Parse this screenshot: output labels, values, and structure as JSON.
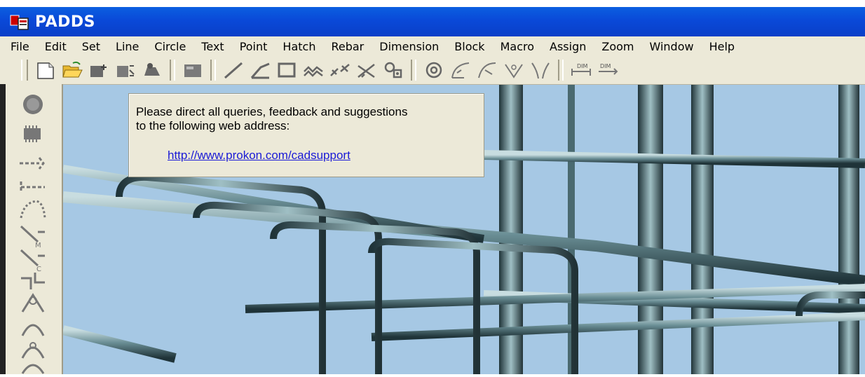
{
  "window": {
    "title": "PADDS"
  },
  "menu": {
    "items": [
      "File",
      "Edit",
      "Set",
      "Line",
      "Circle",
      "Text",
      "Point",
      "Hatch",
      "Rebar",
      "Dimension",
      "Block",
      "Macro",
      "Assign",
      "Zoom",
      "Window",
      "Help"
    ]
  },
  "toolbar": {
    "icons": [
      "new-file-icon",
      "open-folder-icon",
      "insert-block-icon",
      "explode-block-icon",
      "gallery-icon",
      "layer-icon",
      "line-icon",
      "polyline-icon",
      "rectangle-icon",
      "zigzag-icon",
      "break-line-icon",
      "cross-line-icon",
      "chain-icon",
      "circle-point-icon",
      "arc-icon",
      "angle-r-icon",
      "vertex-icon",
      "curve-icon",
      "dimension-icon"
    ],
    "dim_label": "DIM"
  },
  "lefttoolbar": {
    "icons": [
      "globe-icon",
      "chip-icon",
      "line-end-icon",
      "line-start-icon",
      "dotted-curve-icon",
      "rebar-m-icon",
      "rebar-c-icon",
      "hook-icon",
      "bend-r-icon",
      "bend-icon",
      "bend-2d-icon",
      "bend-small-icon"
    ]
  },
  "info": {
    "line1": "Please direct all queries, feedback and suggestions",
    "line2": "to the following web address:",
    "link": "http://www.prokon.com/cadsupport"
  },
  "colors": {
    "titlebar": "#0a49d8",
    "chrome": "#ece9d8",
    "canvas": "#a6c8e4",
    "link": "#1a1ad6"
  }
}
